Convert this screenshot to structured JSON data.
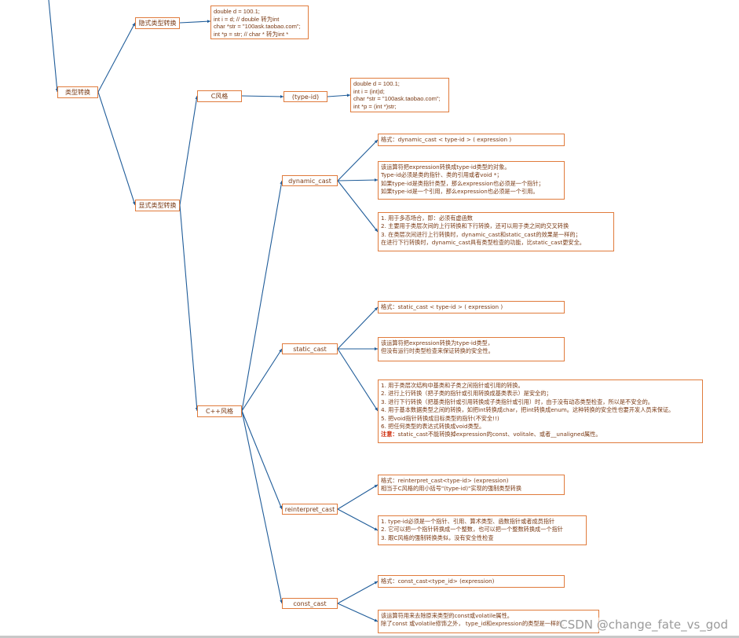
{
  "colors": {
    "line": "#1f5c99",
    "border": "#e07b3c",
    "text": "#7a3a14",
    "warn": "#cc2200"
  },
  "nodes": {
    "type_conversion": "类型转换",
    "implicit": "隐式类型转换",
    "explicit": "显式类型转换",
    "c_style": "C风格",
    "type_id": "(type-id)",
    "cpp_style": "C++风格",
    "dynamic_cast": "dynamic_cast",
    "static_cast": "static_cast",
    "reinterpret_cast": "reinterpret_cast",
    "const_cast": "const_cast"
  },
  "notes": {
    "implicit_code": [
      "double d = 100.1;",
      "int i = d;  // double 转为int",
      "char *str = \"100ask.taobao.com\";",
      "int *p = str; // char * 转为int *"
    ],
    "c_style_code": [
      "double d = 100.1;",
      "int i = (int)d;",
      "char *str = \"100ask.taobao.com\";",
      "int *p = (int *)str;"
    ],
    "dynamic_format": [
      "格式：dynamic_cast < type-id > ( expression )"
    ],
    "dynamic_desc": [
      "该运算符把expression转换成type-id类型的对象。",
      "Type-id必须是类的指针、类的引用或者void *；",
      "如果type-id是类指针类型，那么expression也必须是一个指针；",
      "如果type-id是一个引用，那么expression也必须是一个引用。"
    ],
    "dynamic_usage": [
      "1. 用于多态场合，即：必须有虚函数",
      "2. 主要用于类层次间的上行转换和下行转换，还可以用于类之间的交叉转换",
      "3. 在类层次间进行上行转换时，dynamic_cast和static_cast的效果是一样的；",
      "    在进行下行转换时，dynamic_cast具有类型检查的功能，比static_cast更安全。"
    ],
    "static_format": [
      "格式：static_cast < type-id > ( expression )"
    ],
    "static_desc": [
      "该运算符把expression转换为type-id类型，",
      "但没有运行时类型检查来保证转换的安全性。"
    ],
    "static_usage": [
      "1. 用于类层次结构中基类和子类之间指针或引用的转换。",
      "2. 进行上行转换（把子类的指针或引用转换成基类表示）是安全的；",
      "3. 进行下行转换（把基类指针或引用转换成子类指针或引用）时，由于没有动态类型检查，所以是不安全的。",
      "4. 用于基本数据类型之间的转换，如把int转换成char，把int转换成enum。这种转换的安全性也要开发人员来保证。",
      "5. 把void指针转换成目标类型的指针(不安全!!)",
      "6. 把任何类型的表达式转换成void类型。"
    ],
    "static_warn_label": "注意：",
    "static_warn_text": "static_cast不能转换掉expression的const、volitale、或者__unaligned属性。",
    "reinterpret_format": [
      "格式：reinterpret_cast<type-id> (expression)",
      "相当于C风格的用小括号\"(type-id)\"实现的强制类型转换"
    ],
    "reinterpret_usage": [
      "1. type-id必须是一个指针、引用、算术类型、函数指针或者成员指针",
      "2. 它可以把一个指针转换成一个整数，也可以把一个整数转换成一个指针",
      "3. 跟C风格的强制转换类似，没有安全性检查"
    ],
    "const_format": [
      "格式：const_cast<type_id> (expression)"
    ],
    "const_desc": [
      "该运算符用来去除原来类型的const或volatile属性。",
      "除了const 或volatile修饰之外， type_id和expression的类型是一样的。"
    ]
  },
  "watermark": "CSDN @change_fate_vs_god"
}
